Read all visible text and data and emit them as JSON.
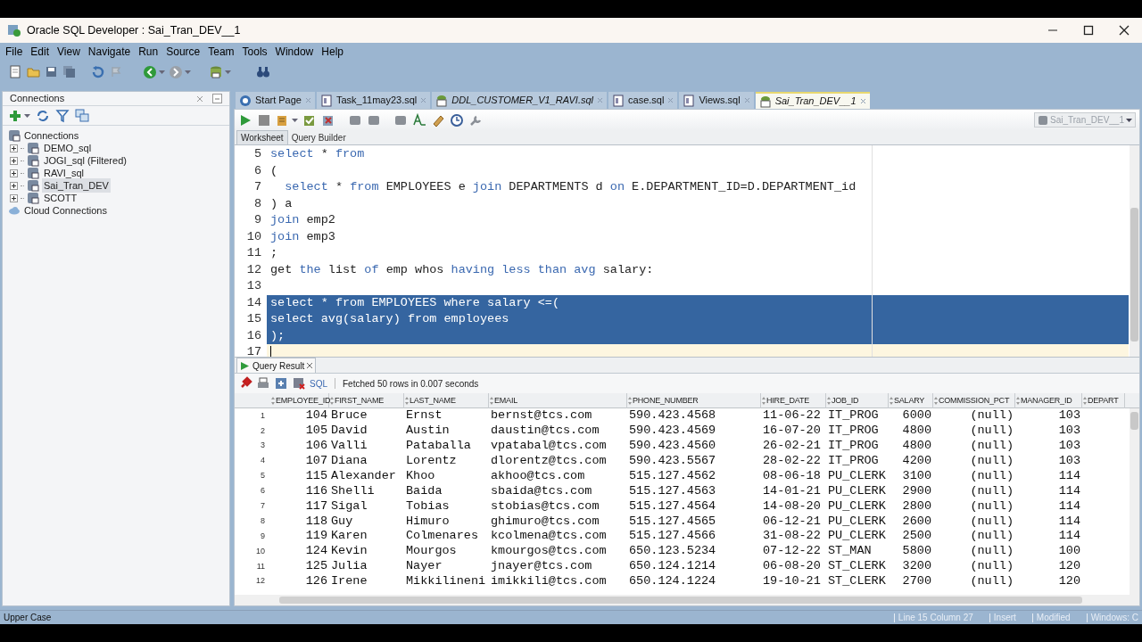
{
  "window": {
    "title": "Oracle SQL Developer : Sai_Tran_DEV__1"
  },
  "menu": [
    "File",
    "Edit",
    "View",
    "Navigate",
    "Run",
    "Source",
    "Team",
    "Tools",
    "Window",
    "Help"
  ],
  "connections_panel": {
    "title": "Connections",
    "tree": [
      {
        "label": "Connections",
        "kind": "root",
        "children": [
          {
            "label": "DEMO_sql",
            "expanded": false,
            "selected": false
          },
          {
            "label": "JOGI_sql (Filtered)",
            "expanded": false,
            "selected": false
          },
          {
            "label": "RAVI_sql",
            "expanded": false,
            "selected": false
          },
          {
            "label": "Sai_Tran_DEV",
            "expanded": false,
            "selected": true
          },
          {
            "label": "SCOTT",
            "expanded": false,
            "selected": false
          }
        ]
      },
      {
        "label": "Cloud Connections",
        "kind": "cloud"
      }
    ]
  },
  "editor_tabs": [
    {
      "label": "Start Page",
      "kind": "help",
      "modified": false,
      "selected": false
    },
    {
      "label": "Task_11may23.sql",
      "kind": "file",
      "modified": false,
      "selected": false
    },
    {
      "label": "DDL_CUSTOMER_V1_RAVI.sql",
      "kind": "db",
      "modified": true,
      "selected": false
    },
    {
      "label": "case.sql",
      "kind": "file",
      "modified": false,
      "selected": false
    },
    {
      "label": "Views.sql",
      "kind": "file",
      "modified": false,
      "selected": false
    },
    {
      "label": "Sai_Tran_DEV__1",
      "kind": "db",
      "modified": true,
      "selected": true
    }
  ],
  "connection_picker": {
    "value": "Sai_Tran_DEV__1"
  },
  "worksheet_tabs": [
    {
      "label": "Worksheet",
      "selected": true
    },
    {
      "label": "Query Builder",
      "selected": false
    }
  ],
  "code_lines": [
    {
      "number": "5",
      "tokens": [
        {
          "text": "select",
          "kind": "keyword"
        },
        {
          "text": " * ",
          "kind": "plain"
        },
        {
          "text": "from",
          "kind": "keyword"
        }
      ]
    },
    {
      "number": "6",
      "tokens": [
        {
          "text": "(",
          "kind": "plain"
        }
      ]
    },
    {
      "number": "7",
      "tokens": [
        {
          "text": "  select",
          "kind": "keyword"
        },
        {
          "text": " * ",
          "kind": "plain"
        },
        {
          "text": "from",
          "kind": "keyword"
        },
        {
          "text": " EMPLOYEES e ",
          "kind": "plain"
        },
        {
          "text": "join",
          "kind": "keyword"
        },
        {
          "text": " DEPARTMENTS d ",
          "kind": "plain"
        },
        {
          "text": "on",
          "kind": "keyword"
        },
        {
          "text": " E.DEPARTMENT_ID=D.DEPARTMENT_id",
          "kind": "plain"
        }
      ]
    },
    {
      "number": "8",
      "tokens": [
        {
          "text": ") a",
          "kind": "plain"
        }
      ]
    },
    {
      "number": "9",
      "tokens": [
        {
          "text": "join",
          "kind": "keyword"
        },
        {
          "text": " emp2",
          "kind": "plain"
        }
      ]
    },
    {
      "number": "10",
      "tokens": [
        {
          "text": "join",
          "kind": "keyword"
        },
        {
          "text": " emp3",
          "kind": "plain"
        }
      ]
    },
    {
      "number": "11",
      "tokens": [
        {
          "text": ";",
          "kind": "plain"
        }
      ]
    },
    {
      "number": "12",
      "tokens": [
        {
          "text": "get ",
          "kind": "plain"
        },
        {
          "text": "the",
          "kind": "keyword"
        },
        {
          "text": " list ",
          "kind": "plain"
        },
        {
          "text": "of",
          "kind": "keyword"
        },
        {
          "text": " emp whos ",
          "kind": "plain"
        },
        {
          "text": "having less than avg",
          "kind": "keyword"
        },
        {
          "text": " salary:",
          "kind": "plain"
        }
      ]
    },
    {
      "number": "13"
    },
    {
      "number": "14",
      "selected": true,
      "text": "select * from EMPLOYEES where salary <=("
    },
    {
      "number": "15",
      "selected": true,
      "text": "select avg(salary) from employees"
    },
    {
      "number": "16",
      "selected": true,
      "text": ");"
    },
    {
      "number": "17",
      "current": true
    }
  ],
  "results": {
    "tab": "Query Result",
    "sql_label": "SQL",
    "message": "Fetched 50 rows in 0.007 seconds",
    "columns": [
      "EMPLOYEE_ID",
      "FIRST_NAME",
      "LAST_NAME",
      "EMAIL",
      "PHONE_NUMBER",
      "HIRE_DATE",
      "JOB_ID",
      "SALARY",
      "COMMISSION_PCT",
      "MANAGER_ID",
      "DEPART"
    ],
    "rows": [
      {
        "number": "1",
        "cells": [
          "104",
          "Bruce",
          "Ernst",
          "bernst@tcs.com",
          "590.423.4568",
          "11-06-22",
          "IT_PROG",
          "6000",
          "(null)",
          "103"
        ]
      },
      {
        "number": "2",
        "cells": [
          "105",
          "David",
          "Austin",
          "daustin@tcs.com",
          "590.423.4569",
          "16-07-20",
          "IT_PROG",
          "4800",
          "(null)",
          "103"
        ]
      },
      {
        "number": "3",
        "cells": [
          "106",
          "Valli",
          "Pataballa",
          "vpatabal@tcs.com",
          "590.423.4560",
          "26-02-21",
          "IT_PROG",
          "4800",
          "(null)",
          "103"
        ]
      },
      {
        "number": "4",
        "cells": [
          "107",
          "Diana",
          "Lorentz",
          "dlorentz@tcs.com",
          "590.423.5567",
          "28-02-22",
          "IT_PROG",
          "4200",
          "(null)",
          "103"
        ]
      },
      {
        "number": "5",
        "cells": [
          "115",
          "Alexander",
          "Khoo",
          "akhoo@tcs.com",
          "515.127.4562",
          "08-06-18",
          "PU_CLERK",
          "3100",
          "(null)",
          "114"
        ]
      },
      {
        "number": "6",
        "cells": [
          "116",
          "Shelli",
          "Baida",
          "sbaida@tcs.com",
          "515.127.4563",
          "14-01-21",
          "PU_CLERK",
          "2900",
          "(null)",
          "114"
        ]
      },
      {
        "number": "7",
        "cells": [
          "117",
          "Sigal",
          "Tobias",
          "stobias@tcs.com",
          "515.127.4564",
          "14-08-20",
          "PU_CLERK",
          "2800",
          "(null)",
          "114"
        ]
      },
      {
        "number": "8",
        "cells": [
          "118",
          "Guy",
          "Himuro",
          "ghimuro@tcs.com",
          "515.127.4565",
          "06-12-21",
          "PU_CLERK",
          "2600",
          "(null)",
          "114"
        ]
      },
      {
        "number": "9",
        "cells": [
          "119",
          "Karen",
          "Colmenares",
          "kcolmena@tcs.com",
          "515.127.4566",
          "31-08-22",
          "PU_CLERK",
          "2500",
          "(null)",
          "114"
        ]
      },
      {
        "number": "10",
        "cells": [
          "124",
          "Kevin",
          "Mourgos",
          "kmourgos@tcs.com",
          "650.123.5234",
          "07-12-22",
          "ST_MAN",
          "5800",
          "(null)",
          "100"
        ]
      },
      {
        "number": "11",
        "cells": [
          "125",
          "Julia",
          "Nayer",
          "jnayer@tcs.com",
          "650.124.1214",
          "06-08-20",
          "ST_CLERK",
          "3200",
          "(null)",
          "120"
        ]
      },
      {
        "number": "12",
        "cells": [
          "126",
          "Irene",
          "Mikkilineni",
          "imikkili@tcs.com",
          "650.124.1224",
          "19-10-21",
          "ST_CLERK",
          "2700",
          "(null)",
          "120"
        ]
      }
    ]
  },
  "status_bar": {
    "left": "Upper Case",
    "items": [
      "Line 15 Column 27",
      "Insert",
      "Modified",
      "Windows: C"
    ]
  }
}
